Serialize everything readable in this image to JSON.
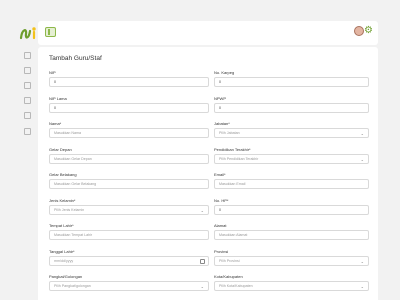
{
  "brand": {
    "logo_text": "SI"
  },
  "sidebar": {
    "icons": [
      "dashboard-icon",
      "grid-icon",
      "folder-icon",
      "document-icon",
      "archive-icon",
      "id-card-icon"
    ]
  },
  "header": {
    "avatar": "user-avatar",
    "settings_icon": "gear-icon"
  },
  "form": {
    "title": "Tambah Guru/Staf",
    "left": [
      {
        "label": "NIP",
        "value": "0",
        "placeholder": ""
      },
      {
        "label": "NIP Lama",
        "value": "0",
        "placeholder": ""
      },
      {
        "label": "Nama*",
        "value": "",
        "placeholder": "Masukkan Nama"
      },
      {
        "label": "Gelar Depan",
        "value": "",
        "placeholder": "Masukkan Gelar Depan"
      },
      {
        "label": "Gelar Belakang",
        "value": "",
        "placeholder": "Masukkan Gelar Belakang"
      },
      {
        "label": "Jenis Kelamin*",
        "value": "",
        "placeholder": "Pilih Jenis Kelamin"
      },
      {
        "label": "Tempat Lahir*",
        "value": "",
        "placeholder": "Masukkan Tempat Lahir"
      },
      {
        "label": "Tanggal Lahir*",
        "value": "",
        "placeholder": "mm/dd/yyyy"
      },
      {
        "label": "Pangkat/Golongan",
        "value": "",
        "placeholder": "Pilih Pangkat/golongan"
      }
    ],
    "right": [
      {
        "label": "No. Karpeg",
        "value": "0",
        "placeholder": ""
      },
      {
        "label": "NPWP",
        "value": "0",
        "placeholder": ""
      },
      {
        "label": "Jabatan*",
        "value": "",
        "placeholder": "Pilih Jabatan"
      },
      {
        "label": "Pendidikan Terakhir*",
        "value": "",
        "placeholder": "Pilih Pendidikan Terakhir"
      },
      {
        "label": "Email*",
        "value": "",
        "placeholder": "Masukkan Email"
      },
      {
        "label": "No. HP*",
        "value": "0",
        "placeholder": ""
      },
      {
        "label": "Alamat",
        "value": "",
        "placeholder": "Masukkan Alamat"
      },
      {
        "label": "Provinsi",
        "value": "",
        "placeholder": "Pilih Provinsi"
      },
      {
        "label": "Kota/Kabupaten",
        "value": "",
        "placeholder": "Pilih Kota/Kabupaten"
      }
    ]
  },
  "colors": {
    "accent": "#8db84a",
    "accent_dark": "#6e9e2e",
    "logo_yellow": "#f2c21b",
    "background": "#f2f2f2"
  }
}
